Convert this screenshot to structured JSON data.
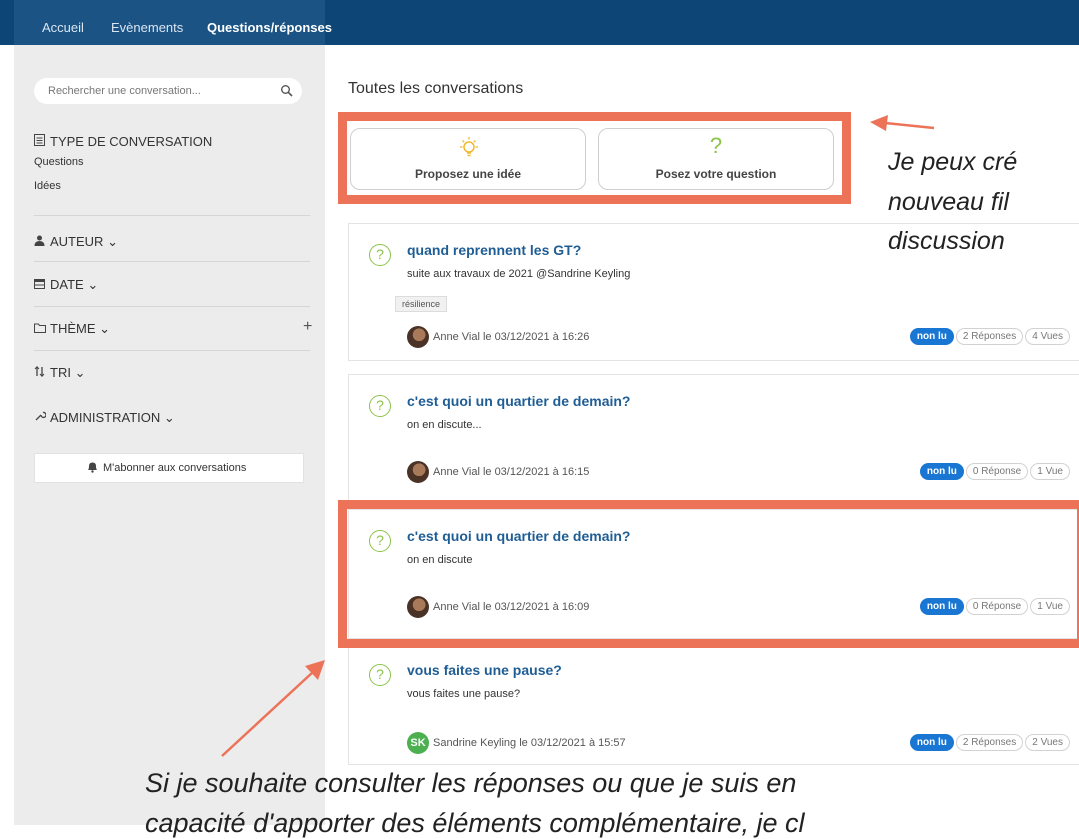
{
  "nav": {
    "items": [
      "Accueil",
      "Evènements",
      "Questions/réponses"
    ],
    "active_index": 2
  },
  "sidebar": {
    "search_placeholder": "Rechercher une conversation...",
    "type_heading": "TYPE DE CONVERSATION",
    "type_items": [
      "Questions",
      "Idées"
    ],
    "author": "AUTEUR",
    "date": "DATE",
    "theme": "THÈME",
    "sort": "TRI",
    "admin": "ADMINISTRATION",
    "caret": "⌄",
    "plus": "+",
    "subscribe": "M'abonner aux conversations"
  },
  "main": {
    "title": "Toutes les conversations",
    "actions": {
      "idea": "Proposez une idée",
      "question": "Posez votre question"
    },
    "question_mark": "?",
    "conversations": [
      {
        "title": "quand reprennent les GT?",
        "excerpt": "suite aux travaux de 2021 @Sandrine Keyling",
        "tag": "résilience",
        "meta": "Anne Vial le 03/12/2021 à 16:26",
        "unread": "non lu",
        "replies": "2 Réponses",
        "views": "4 Vues"
      },
      {
        "title": "c'est quoi un quartier de demain?",
        "excerpt": "on en discute...",
        "meta": "Anne Vial le 03/12/2021 à 16:15",
        "unread": "non lu",
        "replies": "0 Réponse",
        "views": "1 Vue"
      },
      {
        "title": "c'est quoi un quartier de demain?",
        "excerpt": "on en discute",
        "meta": "Anne Vial le 03/12/2021 à 16:09",
        "unread": "non lu",
        "replies": "0 Réponse",
        "views": "1 Vue"
      },
      {
        "title": "vous faites une pause?",
        "excerpt": "vous faites une pause?",
        "avatar_initials": "SK",
        "meta": "Sandrine Keyling le 03/12/2021 à 15:57",
        "unread": "non lu",
        "replies": "2 Réponses",
        "views": "2 Vues"
      }
    ]
  },
  "annotations": {
    "right_lines": [
      "Je peux cré",
      "nouveau fil",
      "discussion"
    ],
    "bottom_lines": [
      "Si je souhaite consulter les réponses ou que je suis en",
      "capacité d'apporter des éléments complémentaire, je cl"
    ]
  },
  "colors": {
    "topbar": "#0d4577",
    "highlight": "#ec7357",
    "link": "#1f5d95",
    "question_green": "#8bc34a",
    "unread_blue": "#1976d2"
  }
}
